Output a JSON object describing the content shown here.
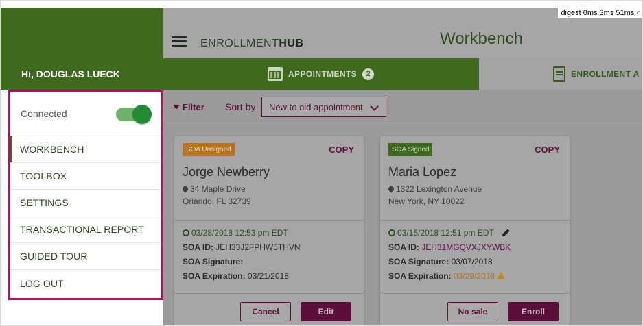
{
  "header": {
    "brand_light": "ENROLLMENT",
    "brand_bold": "HUB",
    "page_title": "Workbench",
    "debug_text": "digest 0ms 3ms 51ms ○"
  },
  "tabs": [
    {
      "label": "APPOINTMENTS",
      "badge": "2",
      "icon": "calendar-icon"
    },
    {
      "label": "ENROLLMENT A",
      "icon": "document-icon"
    }
  ],
  "filterbar": {
    "filter_label": "Filter",
    "sort_label": "Sort by",
    "sort_selected": "New to old appointment"
  },
  "cards": [
    {
      "status": "SOA Unsigned",
      "copy": "COPY",
      "name": "Jorge Newberry",
      "address1": "34 Maple Drive",
      "address2": "Orlando, FL 32739",
      "appointment": "03/28/2018 12:53 pm EDT",
      "soa_id_label": "SOA ID:",
      "soa_id": "JEH33J2FPHW5THVN",
      "signature_label": "SOA Signature:",
      "signature": "",
      "expiration_label": "SOA Expiration:",
      "expiration": "03/21/2018",
      "btn_secondary": "Cancel",
      "btn_primary": "Edit"
    },
    {
      "status": "SOA Signed",
      "copy": "COPY",
      "name": "Maria Lopez",
      "address1": "1322 Lexington Avenue",
      "address2": "New York, NY 10022",
      "appointment": "03/15/2018 12:51 pm EDT",
      "soa_id_label": "SOA ID:",
      "soa_id": "JEH31MGQVXJXYWBK",
      "signature_label": "SOA Signature:",
      "signature": "03/07/2018",
      "expiration_label": "SOA Expiration:",
      "expiration": "03/29/2018",
      "btn_secondary": "No sale",
      "btn_primary": "Enroll"
    }
  ],
  "sidebar": {
    "greeting": "Hi, DOUGLAS LUECK",
    "connected_label": "Connected",
    "connected_on": true,
    "items": [
      {
        "label": "WORKBENCH",
        "active": true
      },
      {
        "label": "TOOLBOX"
      },
      {
        "label": "SETTINGS"
      },
      {
        "label": "TRANSACTIONAL REPORT"
      },
      {
        "label": "GUIDED TOUR"
      },
      {
        "label": "LOG OUT"
      }
    ]
  },
  "colors": {
    "brand_green": "#3f6a1e",
    "accent_maroon": "#5c0f3a",
    "highlight_magenta": "#b0125f",
    "toggle_green": "#228b33",
    "warning_orange": "#c8861a"
  }
}
